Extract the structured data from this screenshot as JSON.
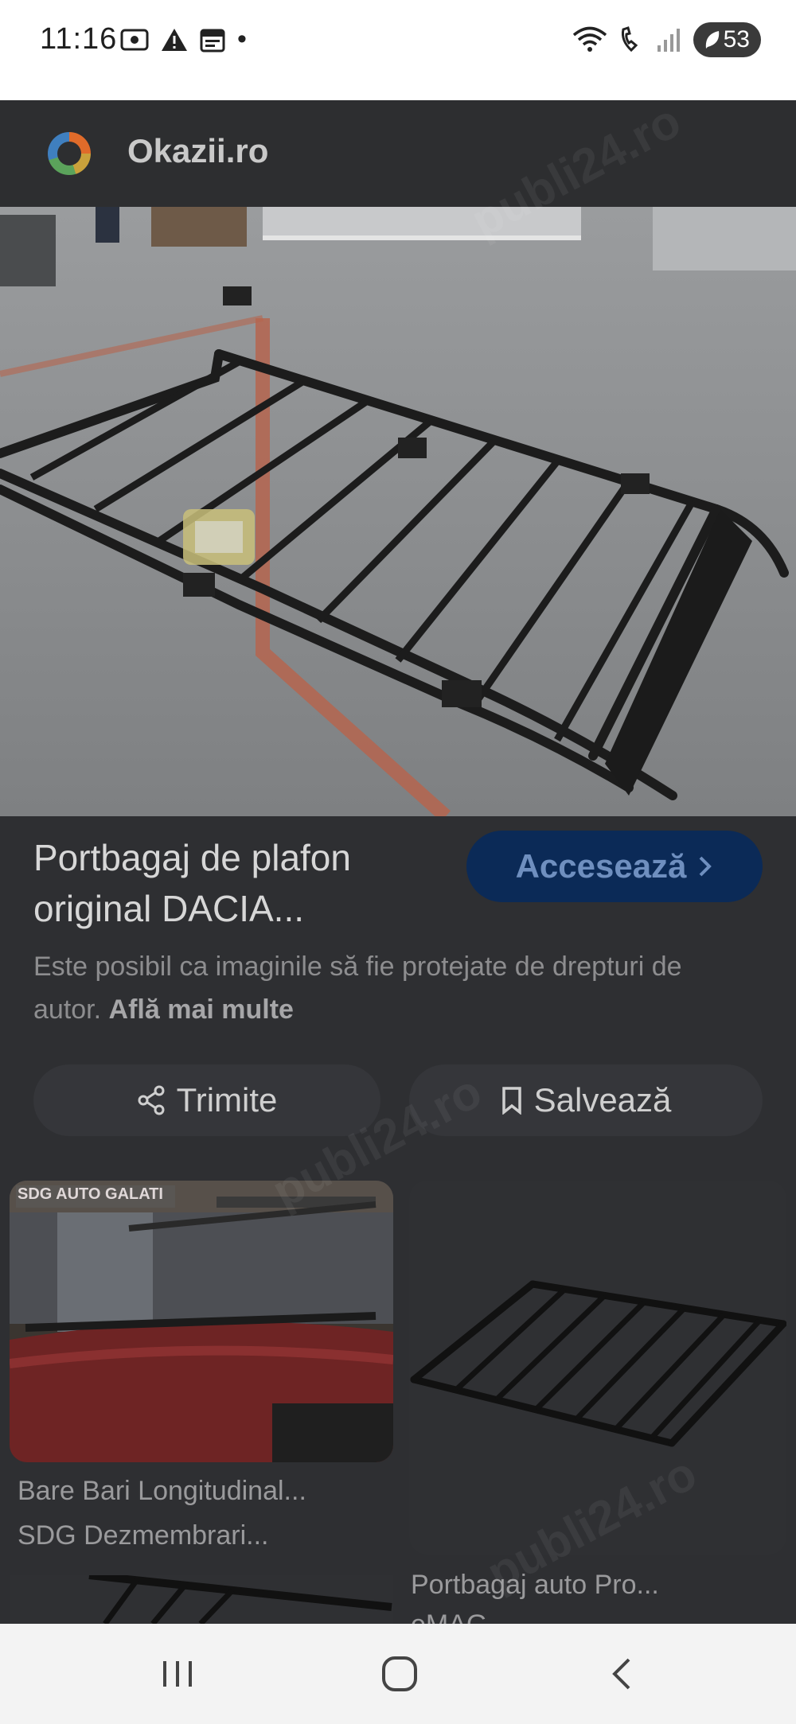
{
  "status_bar": {
    "time": "11:16",
    "battery": "53",
    "dot": "•",
    "icons": [
      "screen-record-icon",
      "warning-icon",
      "calendar-icon",
      "wifi-icon",
      "wifi-call-icon",
      "signal-icon",
      "battery-icon"
    ]
  },
  "source": {
    "name": "Okazii.ro"
  },
  "result": {
    "title_line1": "Portbagaj de plafon",
    "title_line2": "original DACIA...",
    "visit_label": "Accesează",
    "copyright_text": "Este posibil ca imaginile să fie protejate de drepturi de autor.",
    "learn_more": "Află mai multe"
  },
  "actions": {
    "share_label": "Trimite",
    "save_label": "Salvează"
  },
  "related": [
    {
      "badge": "SDG AUTO GALATI",
      "title": "Bare Bari Longitudinal...",
      "source": "SDG Dezmembrari..."
    },
    {
      "title": "Portbagaj auto Pro...",
      "source": "eMAG"
    }
  ],
  "watermark_text": "publi24.ro",
  "colors": {
    "accent_button_bg": "#0b2a57",
    "accent_button_text": "#6f8fbf",
    "status_bar_bg": "#ffffff",
    "nav_bar_bg": "#f3f3f3"
  }
}
